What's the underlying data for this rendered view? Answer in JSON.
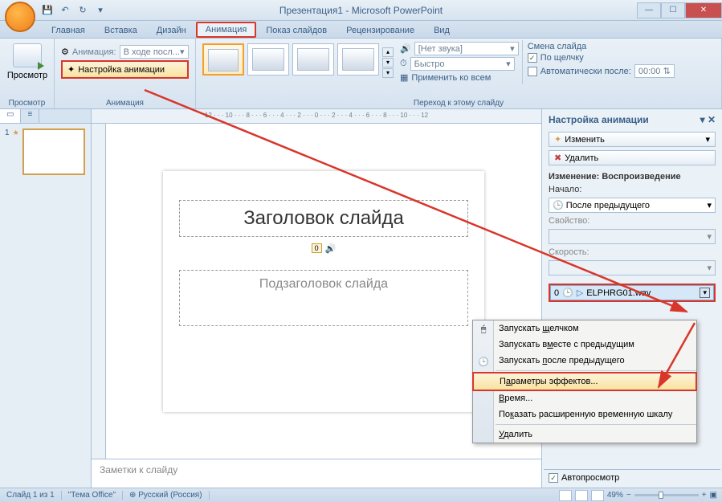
{
  "title": "Презентация1 - Microsoft PowerPoint",
  "tabs": {
    "home": "Главная",
    "insert": "Вставка",
    "design": "Дизайн",
    "animation": "Анимация",
    "slideshow": "Показ слайдов",
    "review": "Рецензирование",
    "view": "Вид"
  },
  "ribbon": {
    "preview": "Просмотр",
    "preview_group": "Просмотр",
    "anim_label": "Анимация:",
    "anim_value": "В ходе посл...",
    "custom_anim": "Настройка анимации",
    "anim_group": "Анимация",
    "no_sound": "[Нет звука]",
    "fast": "Быстро",
    "apply_all": "Применить ко всем",
    "trans_label": "Смена слайда",
    "on_click": "По щелчку",
    "auto_after": "Автоматически после:",
    "auto_time": "00:00",
    "trans_group": "Переход к этому слайду"
  },
  "ruler": "12 · · · 10 · · · 8 · · · 6 · · · 4 · · · 2 · · · 0 · · · 2 · · · 4 · · · 6 · · · 8 · · · 10 · · · 12",
  "slide": {
    "num": "1",
    "title_ph": "Заголовок слайда",
    "subtitle_ph": "Подзаголовок слайда",
    "audio_num": "0",
    "notes": "Заметки к слайду"
  },
  "taskpane": {
    "title": "Настройка анимации",
    "modify": "Изменить",
    "delete": "Удалить",
    "change_title": "Изменение: Воспроизведение",
    "start_label": "Начало:",
    "start_value": "После предыдущего",
    "property_label": "Свойство:",
    "speed_label": "Скорость:",
    "item_index": "0",
    "item_name": "ELPHRG01.wav",
    "autopreview": "Автопросмотр"
  },
  "context_menu": {
    "on_click": "Запускать щелчком",
    "with_prev": "Запускать вместе с предыдущим",
    "after_prev": "Запускать после предыдущего",
    "effect_params": "Параметры эффектов...",
    "timing": "Время...",
    "show_timeline": "Показать расширенную временную шкалу",
    "remove": "Удалить"
  },
  "status": {
    "slide_count": "Слайд 1 из 1",
    "theme": "\"Тема Office\"",
    "lang": "Русский (Россия)",
    "zoom": "49%"
  }
}
